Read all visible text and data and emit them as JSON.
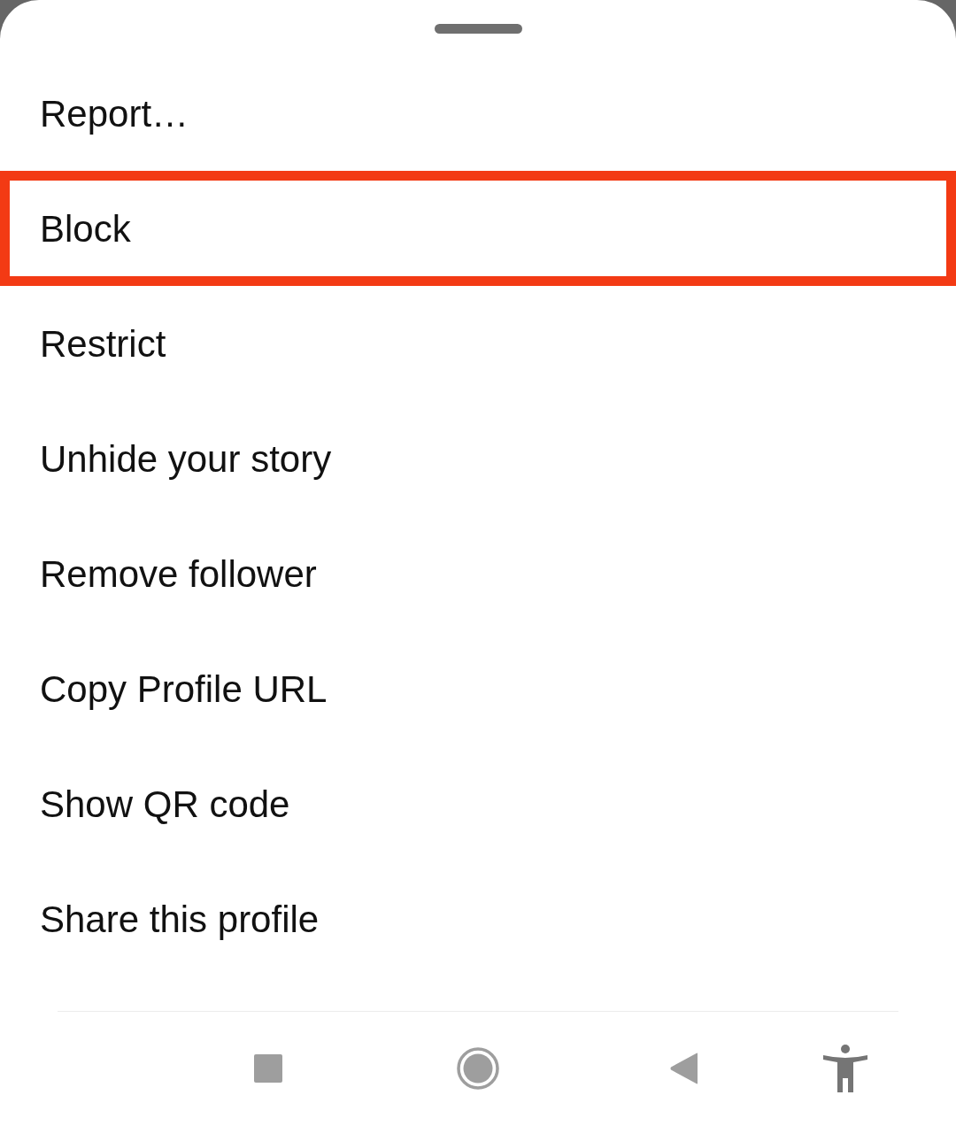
{
  "menu": {
    "items": [
      {
        "label": "Report…",
        "highlighted": false
      },
      {
        "label": "Block",
        "highlighted": true
      },
      {
        "label": "Restrict",
        "highlighted": false
      },
      {
        "label": "Unhide your story",
        "highlighted": false
      },
      {
        "label": "Remove follower",
        "highlighted": false
      },
      {
        "label": "Copy Profile URL",
        "highlighted": false
      },
      {
        "label": "Show QR code",
        "highlighted": false
      },
      {
        "label": "Share this profile",
        "highlighted": false
      }
    ]
  }
}
